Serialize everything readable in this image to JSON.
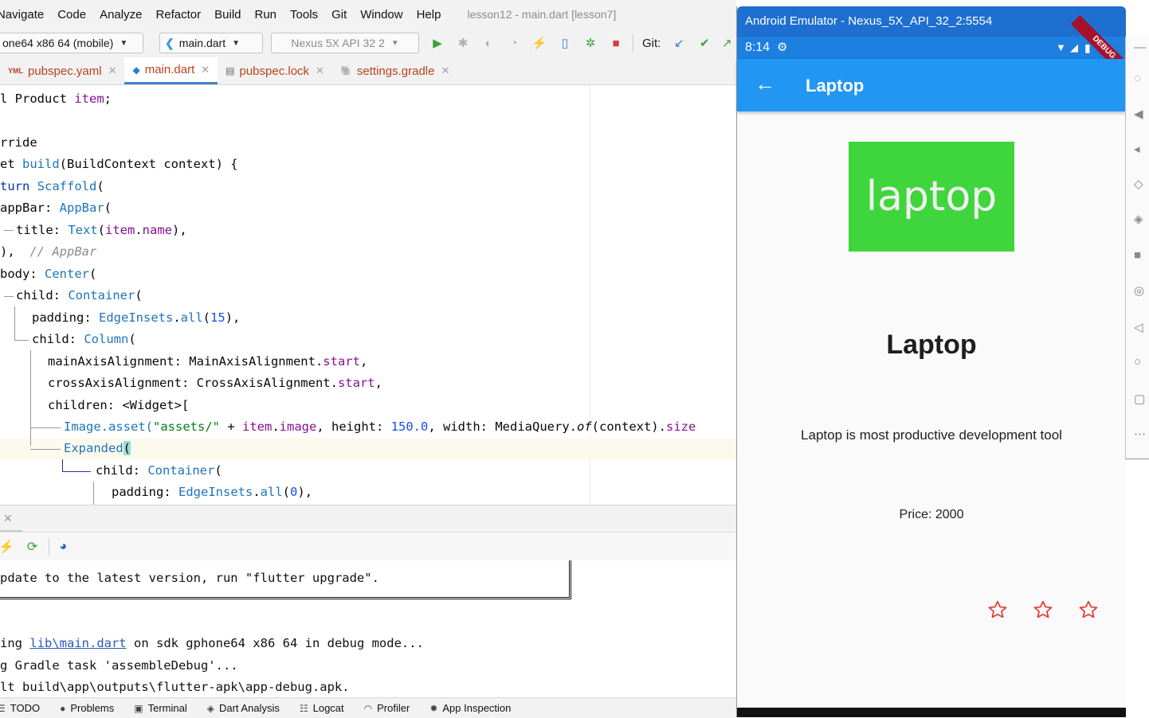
{
  "menu": [
    "Navigate",
    "Code",
    "Analyze",
    "Refactor",
    "Build",
    "Run",
    "Tools",
    "Git",
    "Window",
    "Help"
  ],
  "window_title": "lesson12 - main.dart [lesson7]",
  "toolbar": {
    "device_combo": "one64 x86 64 (mobile)",
    "run_config": "main.dart",
    "avd_combo": "Nexus 5X API 32 2",
    "git_label": "Git:"
  },
  "tabs": [
    {
      "label": "pubspec.yaml",
      "active": false
    },
    {
      "label": "main.dart",
      "active": true
    },
    {
      "label": "pubspec.lock",
      "active": false
    },
    {
      "label": "settings.gradle",
      "active": false
    }
  ],
  "code": {
    "l1_a": "l Product ",
    "l1_b": "item",
    "l1_c": ";",
    "l2": "rride",
    "l3_a": "et ",
    "l3_b": "build",
    "l3_c": "(BuildContext context) {",
    "l4_a": "turn ",
    "l4_b": "Scaffold",
    "l4_c": "(",
    "l5_a": "appBar: ",
    "l5_b": "AppBar",
    "l5_c": "(",
    "l6_a": "title: ",
    "l6_b": "Text",
    "l6_c": "(",
    "l6_d": "item",
    "l6_e": ".",
    "l6_f": "name",
    "l6_g": "),",
    "l7_a": "),  ",
    "l7_b": "// AppBar",
    "l8_a": "body: ",
    "l8_b": "Center",
    "l8_c": "(",
    "l9_a": "child: ",
    "l9_b": "Container",
    "l9_c": "(",
    "l10_a": "padding: ",
    "l10_b": "EdgeInsets",
    "l10_c": ".",
    "l10_d": "all",
    "l10_e": "(",
    "l10_f": "15",
    "l10_g": "),",
    "l11_a": "child: ",
    "l11_b": "Column",
    "l11_c": "(",
    "l12_a": "mainAxisAlignment: MainAxisAlignment.",
    "l12_b": "start",
    "l12_c": ",",
    "l13_a": "crossAxisAlignment: CrossAxisAlignment.",
    "l13_b": "start",
    "l13_c": ",",
    "l14": "children: <Widget>[",
    "l15_a": "Image",
    "l15_b": ".asset(",
    "l15_c": "\"assets/\"",
    "l15_d": " + ",
    "l15_e": "item",
    "l15_f": ".",
    "l15_g": "image",
    "l15_h": ", height: ",
    "l15_i": "150.0",
    "l15_j": ", width: MediaQuery.",
    "l15_k": "of",
    "l15_l": "(context).",
    "l15_m": "size",
    "l16_a": "Expanded",
    "l16_b": "(",
    "l17_a": "child: ",
    "l17_b": "Container",
    "l17_c": "(",
    "l18_a": "padding: ",
    "l18_b": "EdgeInsets",
    "l18_c": ".",
    "l18_d": "all",
    "l18_e": "(",
    "l18_f": "0",
    "l18_g": "),"
  },
  "console": {
    "line1": "pdate to the latest version, run \"flutter upgrade\".",
    "line2_a": "ing ",
    "line2_link": "lib\\main.dart",
    "line2_b": " on sdk gphone64 x86 64 in debug mode...",
    "line3": "g Gradle task 'assembleDebug'...",
    "line4": "lt build\\app\\outputs\\flutter-apk\\app-debug.apk."
  },
  "statusbar": [
    "TODO",
    "Problems",
    "Terminal",
    "Dart Analysis",
    "Logcat",
    "Profiler",
    "App Inspection"
  ],
  "emulator": {
    "title": "Android Emulator - Nexus_5X_API_32_2:5554",
    "time": "8:14",
    "debug_label": "DEBUG",
    "appbar_title": "Laptop",
    "image_text": "laptop",
    "product_name": "Laptop",
    "product_description": "Laptop is most productive development tool",
    "product_price": "Price: 2000",
    "rating_stars": 0,
    "star_color": "#e53935"
  },
  "colors": {
    "appbar": "#2196f3",
    "emulator_title": "#1e6fd0",
    "image_bg": "#3fd53c"
  }
}
